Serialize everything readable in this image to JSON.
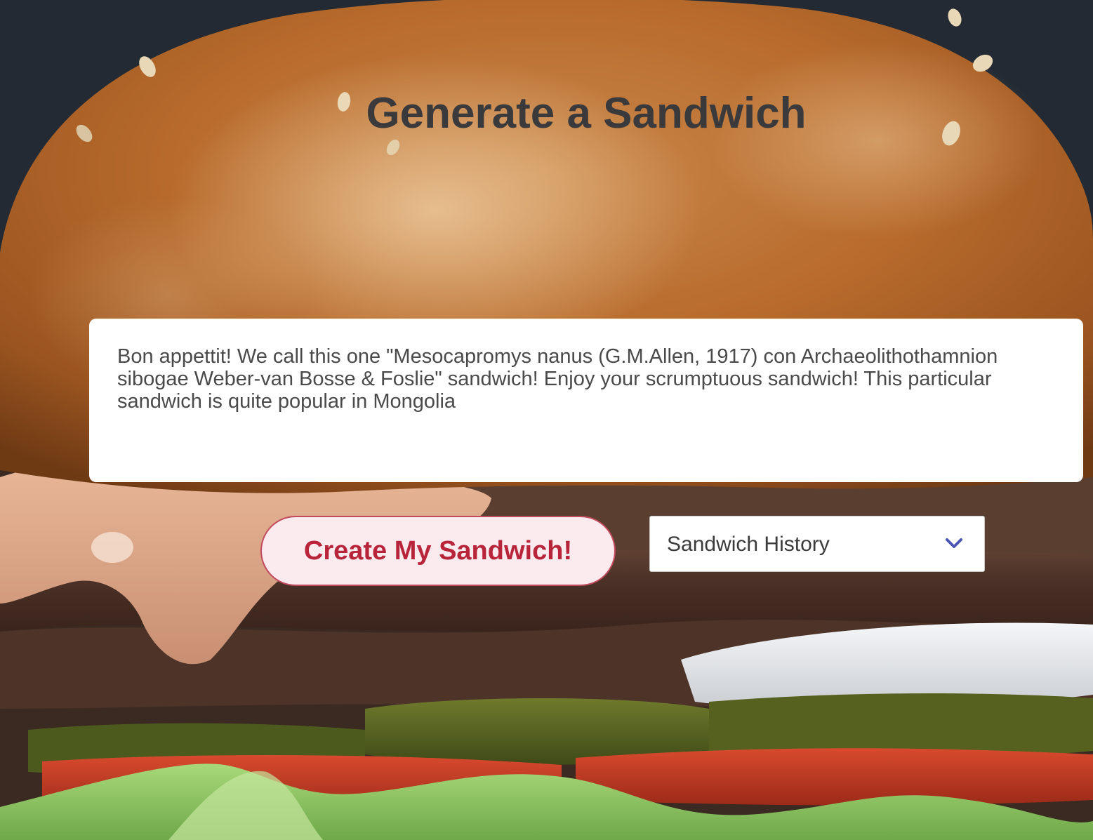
{
  "page": {
    "title": "Generate a Sandwich"
  },
  "result": {
    "text": "Bon appettit! We call this one \"Mesocapromys nanus (G.M.Allen, 1917) con Archaeolithothamnion sibogae Weber-van Bosse & Foslie\" sandwich! Enjoy your scrumptuous sandwich! This particular sandwich is quite popular in Mongolia"
  },
  "actions": {
    "create_label": "Create My Sandwich!"
  },
  "history": {
    "selected": "Sandwich History",
    "icon": "chevron-down-icon"
  },
  "colors": {
    "title": "#3a3a3c",
    "button_text": "#b8253a",
    "button_bg": "#fbeaee",
    "button_border": "#c24a5c",
    "chevron": "#4a55b5"
  }
}
